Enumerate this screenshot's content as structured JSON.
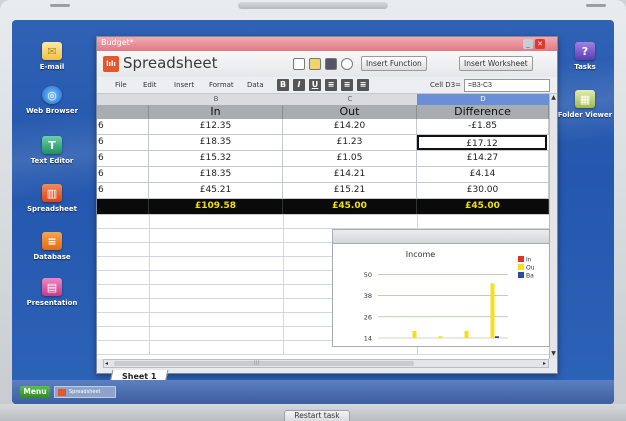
{
  "window": {
    "title": "Budget*",
    "app_name": "Spreadsheet",
    "insert_function_label": "Insert Function",
    "insert_worksheet_label": "Insert Worksheet"
  },
  "menu": [
    "File",
    "Edit",
    "Insert",
    "Format",
    "Data"
  ],
  "format_buttons": [
    "B",
    "I",
    "U"
  ],
  "formula_bar": {
    "cell_label": "Cell D3=",
    "value": "=B3-C3"
  },
  "columns": [
    "B",
    "C",
    "D"
  ],
  "headers": [
    "In",
    "Out",
    "Difference"
  ],
  "rows": [
    {
      "a": "6",
      "in": "£12.35",
      "out": "£14.20",
      "diff": "-£1.85"
    },
    {
      "a": "6",
      "in": "£18.35",
      "out": "£1.23",
      "diff": "£17.12"
    },
    {
      "a": "6",
      "in": "£15.32",
      "out": "£1.05",
      "diff": "£14.27"
    },
    {
      "a": "6",
      "in": "£18.35",
      "out": "£14.21",
      "diff": "£4.14"
    },
    {
      "a": "6",
      "in": "£45.21",
      "out": "£15.21",
      "diff": "£30.00"
    }
  ],
  "totals": {
    "in": "£109.58",
    "out": "£45.00",
    "diff": "£45.00"
  },
  "chart_data": {
    "type": "bar",
    "title": "Income",
    "yticks": [
      14,
      26,
      38,
      50
    ],
    "ylim": [
      14,
      56
    ],
    "legend_placement": "right",
    "categories": [
      "1",
      "2",
      "3",
      "4",
      "5"
    ],
    "series": [
      {
        "name": "In",
        "color": "#e0312b",
        "values": []
      },
      {
        "name": "Ou",
        "color": "#f3e21b",
        "values": [
          14,
          18,
          15,
          18,
          45
        ]
      },
      {
        "name": "Ba",
        "color": "#2a49a8",
        "values": [
          12,
          0,
          0,
          14,
          15
        ]
      }
    ]
  },
  "sheet_tab": "Sheet 1",
  "left_dock": [
    "E-mail",
    "Web Browser",
    "Text Editor",
    "Spreadsheet",
    "Database",
    "Presentation"
  ],
  "right_dock": [
    "Tasks",
    "Folder Viewer"
  ],
  "taskbar": {
    "menu_label": "Menu",
    "task_label": "Spreadsheet"
  },
  "restart_label": "Restart task",
  "colors": {
    "desktop": "#2457ad",
    "title_bar": "#df7a85",
    "selected_column": "#6a8fd6",
    "total_text": "#f2e100"
  }
}
